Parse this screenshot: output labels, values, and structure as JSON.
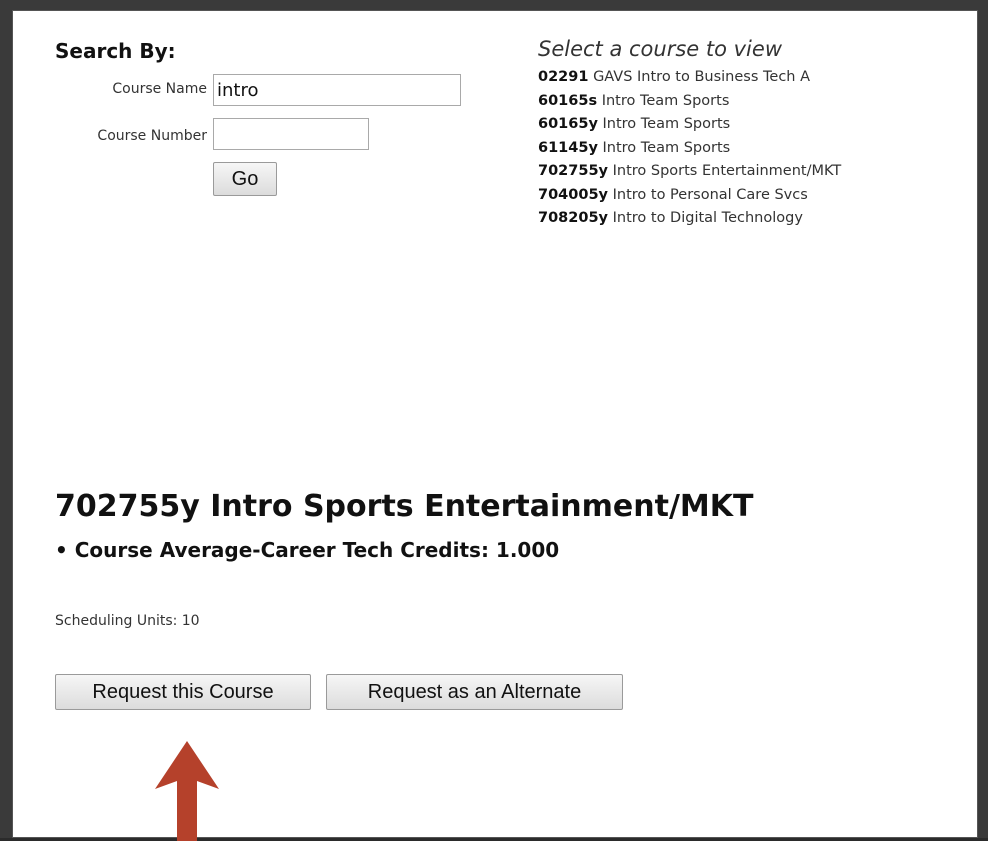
{
  "search": {
    "heading": "Search By:",
    "course_name_label": "Course Name",
    "course_name_value": "intro",
    "course_number_label": "Course Number",
    "course_number_value": "",
    "go_label": "Go"
  },
  "course_list": {
    "title": "Select a course to view",
    "items": [
      {
        "number": "02291",
        "name": "GAVS Intro to Business Tech A"
      },
      {
        "number": "60165s",
        "name": "Intro Team Sports"
      },
      {
        "number": "60165y",
        "name": "Intro Team Sports"
      },
      {
        "number": "61145y",
        "name": "Intro Team Sports"
      },
      {
        "number": "702755y",
        "name": "Intro Sports Entertainment/MKT"
      },
      {
        "number": "704005y",
        "name": "Intro to Personal Care Svcs"
      },
      {
        "number": "708205y",
        "name": "Intro to Digital Technology"
      }
    ]
  },
  "detail": {
    "title": "702755y Intro Sports Entertainment/MKT",
    "bullet": "• Course Average-Career Tech Credits: 1.000",
    "scheduling_units": "Scheduling Units: 10",
    "request_label": "Request this Course",
    "alternate_label": "Request as an Alternate"
  },
  "colors": {
    "arrow": "#b5412b"
  }
}
